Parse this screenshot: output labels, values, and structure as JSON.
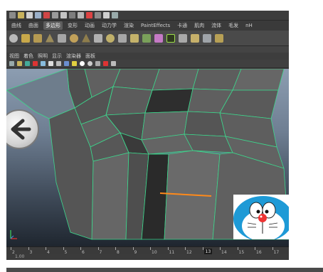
{
  "shelf": {
    "tabs": [
      "曲线",
      "曲面",
      "多边形",
      "变形",
      "动画",
      "动力学",
      "渲染",
      "PaintEffects",
      "卡通",
      "肌肉",
      "流体",
      "毛发",
      "nH"
    ],
    "active_tab": "多边形"
  },
  "panel": {
    "menu": [
      "视图",
      "着色",
      "照明",
      "显示",
      "渲染器",
      "面板"
    ]
  },
  "timeline": {
    "ticks": [
      "2",
      "3",
      "4",
      "5",
      "6",
      "7",
      "8",
      "9",
      "10",
      "11",
      "12",
      "13",
      "14",
      "15",
      "16",
      "17"
    ],
    "current_frame": "13"
  },
  "bottom": {
    "field": "1.00"
  },
  "colors": {
    "wireframe": "#3dd68c",
    "selected_edge": "#ff8a1a",
    "mesh": "#5e5e5e"
  },
  "icons": {
    "back": "back-arrow-icon",
    "axis": "axis-indicator-icon"
  }
}
